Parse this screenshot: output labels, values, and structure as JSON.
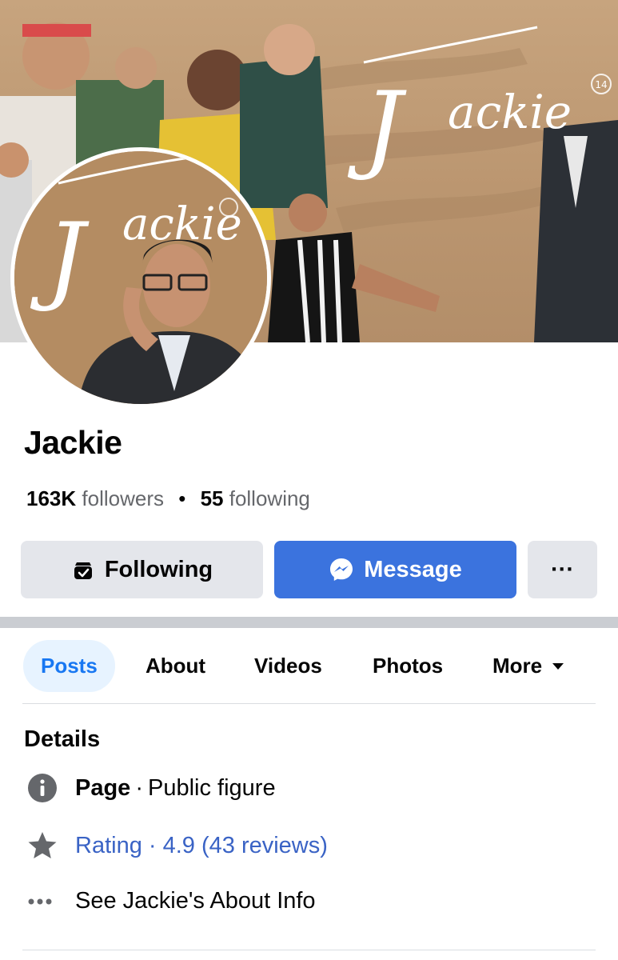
{
  "profile": {
    "name": "Jackie",
    "followers_count": "163K",
    "followers_label": "followers",
    "following_count": "55",
    "following_label": "following",
    "cover_wordmark": "Jackie",
    "cover_badge": "14"
  },
  "actions": {
    "following_label": "Following",
    "message_label": "Message",
    "more_label": "···"
  },
  "tabs": [
    {
      "label": "Posts",
      "active": true
    },
    {
      "label": "About",
      "active": false
    },
    {
      "label": "Videos",
      "active": false
    },
    {
      "label": "Photos",
      "active": false
    },
    {
      "label": "More",
      "active": false
    }
  ],
  "details": {
    "title": "Details",
    "page_label": "Page",
    "page_category": "Public figure",
    "rating_text": "Rating · 4.9 (43 reviews)",
    "about_text": "See Jackie's About Info"
  },
  "colors": {
    "accent": "#1877f2",
    "message_button": "#3b73de",
    "link": "#3a63c5",
    "secondary_button": "#e4e6eb",
    "muted_text": "#65676b"
  },
  "icons": [
    "following-check-icon",
    "messenger-icon",
    "more-dots-icon",
    "caret-down-icon",
    "info-icon",
    "star-icon",
    "dots-icon"
  ]
}
